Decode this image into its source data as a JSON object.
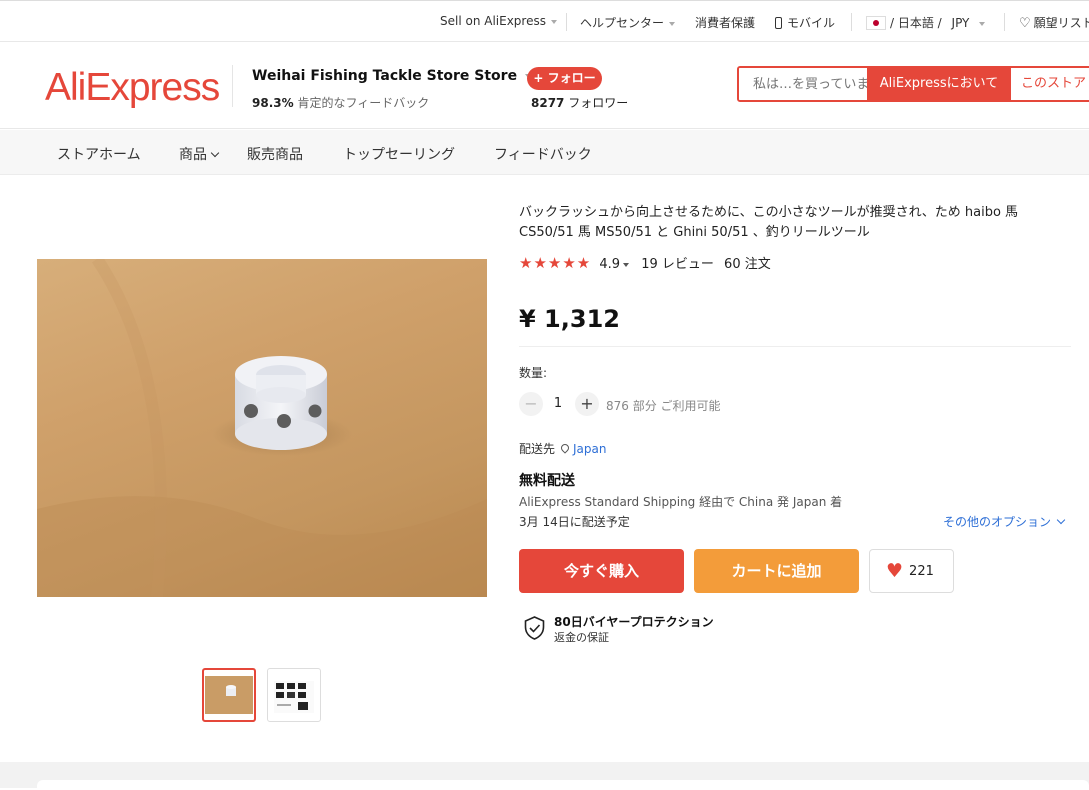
{
  "topbar": {
    "sell": "Sell on AliExpress",
    "help": "ヘルプセンター",
    "protection": "消費者保護",
    "mobile": "モバイル",
    "language": "/ 日本語 /",
    "currency": "JPY",
    "wishlist": "願望リスト"
  },
  "header": {
    "logo": "AliExpress",
    "store_name": "Weihai Fishing Tackle Store Store",
    "feedback_pct": "98.3%",
    "feedback_label": "肯定的なフィードバック",
    "follow_button": "+ フォロー",
    "followers_count": "8277",
    "followers_label": "フォロワー",
    "search_placeholder": "私は…を買っています",
    "search_aliexpress": "AliExpressにおいて",
    "search_store": "このストア"
  },
  "nav": {
    "items": [
      "ストアホーム",
      "商品",
      "販売商品",
      "トップセーリング",
      "フィードバック"
    ]
  },
  "product": {
    "title": "バックラッシュから向上させるために、この小さなツールが推奨され、ため haibo 馬 CS50/51 馬 MS50/51 と Ghini 50/51 、釣りリールツール",
    "stars": "★★★★★",
    "rating": "4.9",
    "reviews": "19 レビュー",
    "orders": "60 注文",
    "price": "¥ 1,312",
    "qty_label": "数量:",
    "qty_minus": "−",
    "qty_value": "1",
    "qty_plus": "+",
    "available": "876 部分 ご利用可能",
    "ship_to_label": "配送先",
    "ship_to_location": "Japan",
    "free_shipping": "無料配送",
    "shipping_method": "AliExpress Standard Shipping 経由で China 発 Japan 着",
    "delivery_estimate": "3月 14日に配送予定",
    "more_options": "その他のオプション",
    "buy_now": "今すぐ購入",
    "add_to_cart": "カートに追加",
    "wish_count": "221",
    "protection_title": "80日バイヤープロテクション",
    "protection_sub": "返金の保証"
  },
  "colors": {
    "accent": "#e5473a",
    "cart": "#f39c3a",
    "link": "#2e6fd6"
  }
}
